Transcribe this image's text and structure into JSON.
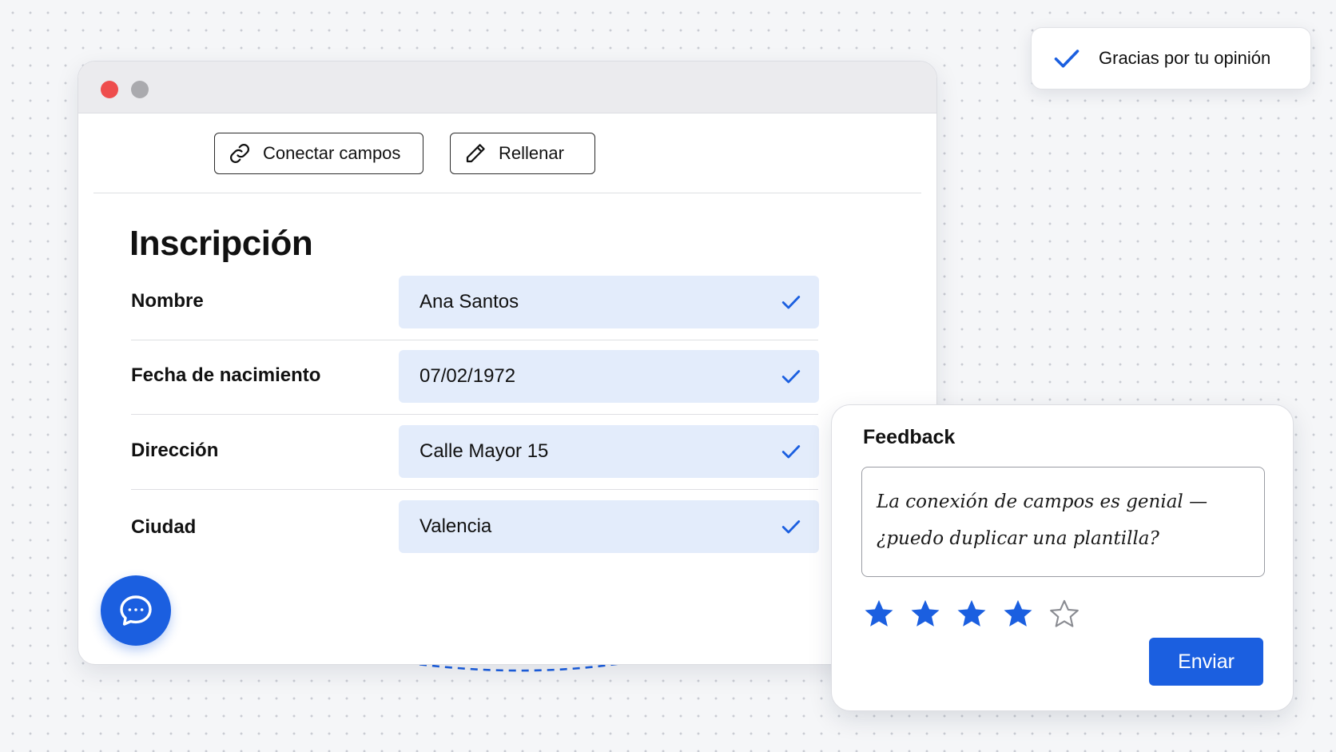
{
  "toast": {
    "message": "Gracias por tu opinión",
    "icon": "check-icon"
  },
  "toolbar": {
    "connect_label": "Conectar campos",
    "connect_icon": "link-icon",
    "fill_label": "Rellenar",
    "fill_icon": "pencil-icon"
  },
  "form": {
    "title": "Inscripción",
    "fields": [
      {
        "label": "Nombre",
        "value": "Ana Santos",
        "status_icon": "check-icon"
      },
      {
        "label": "Fecha de nacimiento",
        "value": "07/02/1972",
        "status_icon": "check-icon"
      },
      {
        "label": "Dirección",
        "value": "Calle Mayor 15",
        "status_icon": "check-icon"
      },
      {
        "label": "Ciudad",
        "value": "Valencia",
        "status_icon": "check-icon"
      }
    ]
  },
  "chat_button": {
    "icon": "chat-bubble-icon"
  },
  "feedback": {
    "title": "Feedback",
    "text": "La conexión de campos es genial —\n¿puedo duplicar una plantilla?",
    "rating": 4,
    "rating_max": 5,
    "submit_label": "Enviar"
  },
  "colors": {
    "accent": "#1b5fe0",
    "field_bg": "#e3ecfb",
    "window_close": "#ee4d4d",
    "window_minimize": "#aaaaae"
  }
}
